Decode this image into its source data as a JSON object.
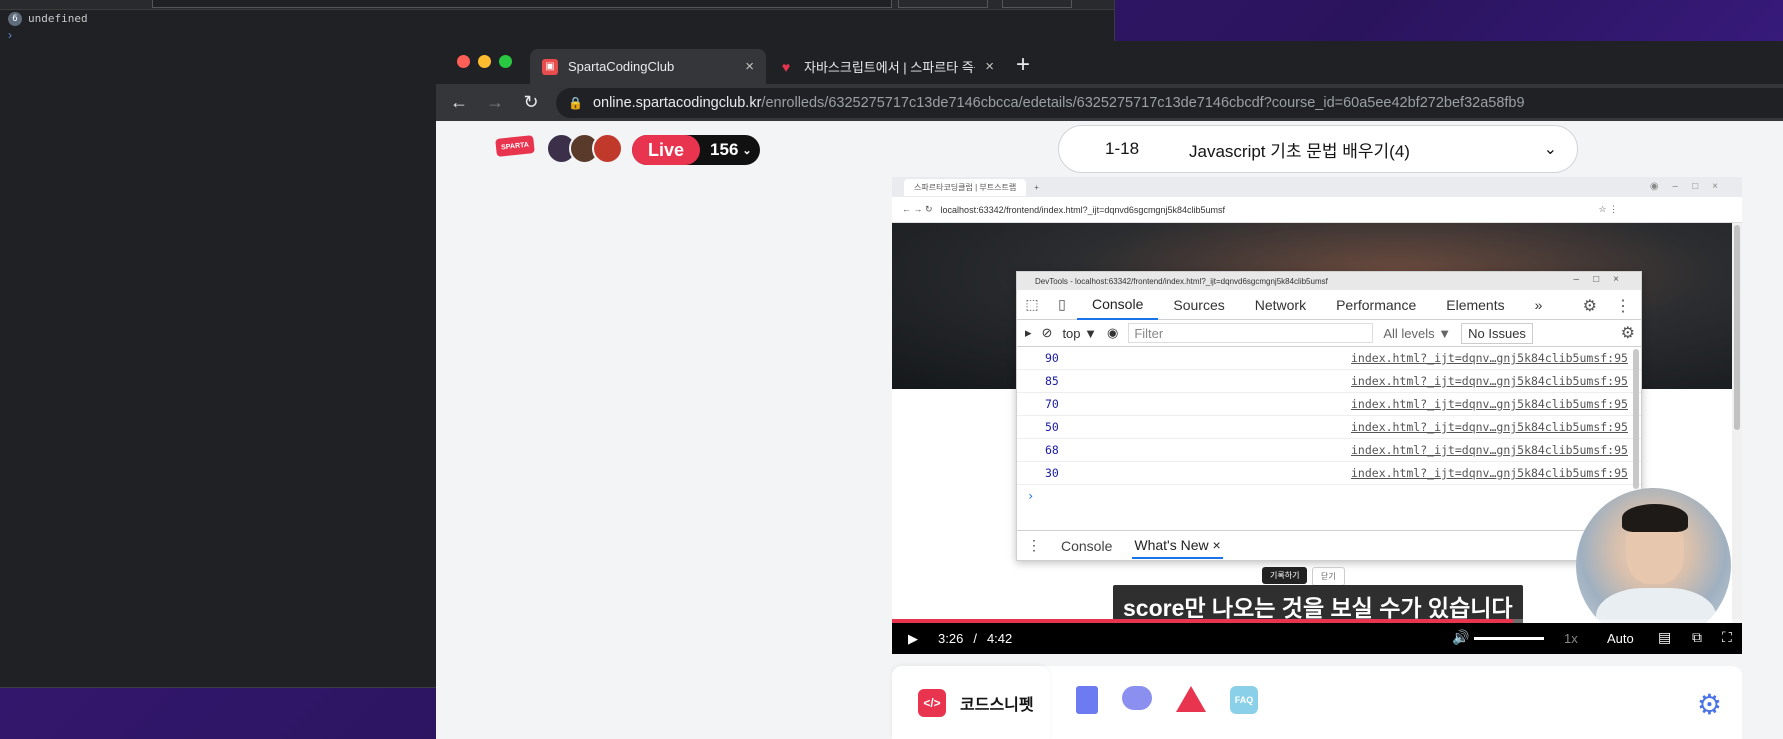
{
  "bg_console": {
    "badge": "6",
    "output": "undefined",
    "prompt": "›"
  },
  "browser": {
    "tabs": [
      {
        "title": "SpartaCodingClub",
        "close": "×"
      },
      {
        "title": "자바스크립트에서 | 스파르타 즉문즉",
        "close": "×"
      }
    ],
    "new_tab": "+",
    "url_host": "online.spartacodingclub.kr",
    "url_path": "/enrolleds/6325275717c13de7146cbcca/edetails/6325275717c13de7146cbcdf?course_id=60a5ee42bf272bef32a58fb9"
  },
  "header": {
    "logo": "SPARTA",
    "live_label": "Live",
    "live_count": "156",
    "lesson_number": "1-18",
    "lesson_title": "Javascript 기초 문법 배우기(4)"
  },
  "video": {
    "inner_tab_title": "스파르타코딩클럽 | 부트스트랩",
    "inner_url": "localhost:63342/frontend/index.html?_ijt=dqnvd6sgcmgnj5k84clib5umsf",
    "devtools": {
      "title": "DevTools - localhost:63342/frontend/index.html?_ijt=dqnvd6sgcmgnj5k84clib5umsf",
      "tabs": [
        "Console",
        "Sources",
        "Network",
        "Performance",
        "Elements"
      ],
      "more": "»",
      "context": "top ▼",
      "filter_placeholder": "Filter",
      "levels": "All levels ▼",
      "issues": "No Issues",
      "rows": [
        {
          "value": "90",
          "source": "index.html?_ijt=dqnv…gnj5k84clib5umsf:95"
        },
        {
          "value": "85",
          "source": "index.html?_ijt=dqnv…gnj5k84clib5umsf:95"
        },
        {
          "value": "70",
          "source": "index.html?_ijt=dqnv…gnj5k84clib5umsf:95"
        },
        {
          "value": "50",
          "source": "index.html?_ijt=dqnv…gnj5k84clib5umsf:95"
        },
        {
          "value": "68",
          "source": "index.html?_ijt=dqnv…gnj5k84clib5umsf:95"
        },
        {
          "value": "30",
          "source": "index.html?_ijt=dqnv…gnj5k84clib5umsf:95"
        }
      ],
      "prompt": "›",
      "drawer_tabs": [
        "Console",
        "What's New"
      ],
      "drawer_close": "×"
    },
    "web_buttons": [
      "기록하기",
      "닫기"
    ],
    "subtitle": "score만 나오는 것을 보실 수가 있습니다",
    "current_time": "3:26",
    "time_separator": "/",
    "duration": "4:42",
    "progress_fraction": 0.73,
    "speed": "1x",
    "quality": "Auto"
  },
  "bottombar": {
    "snippet_label": "코드스니펫",
    "faq_label": "FAQ"
  },
  "colors": {
    "brand_red": "#e8344e",
    "devtools_accent": "#1a73e8"
  }
}
